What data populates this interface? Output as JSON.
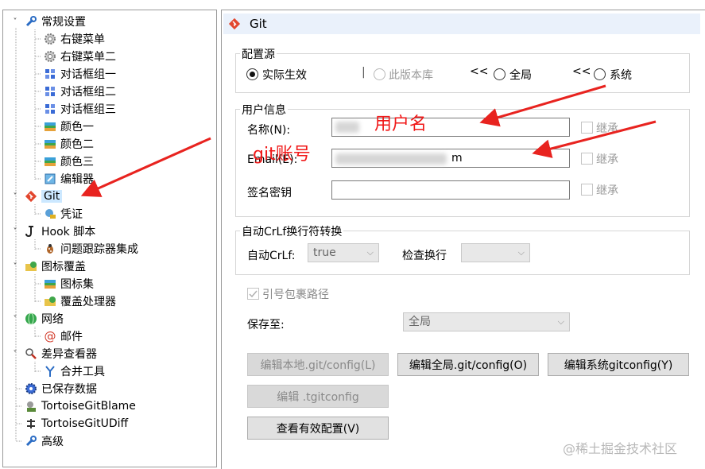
{
  "tree": {
    "items": [
      {
        "label": "常规设置",
        "icon": "wrench-icon"
      },
      {
        "label": "右键菜单",
        "icon": "gear-icon"
      },
      {
        "label": "右键菜单二",
        "icon": "gear-icon"
      },
      {
        "label": "对话框组一",
        "icon": "windows-icon"
      },
      {
        "label": "对话框组二",
        "icon": "windows-icon"
      },
      {
        "label": "对话框组三",
        "icon": "windows-icon"
      },
      {
        "label": "颜色一",
        "icon": "palette-icon"
      },
      {
        "label": "颜色二",
        "icon": "palette-icon"
      },
      {
        "label": "颜色三",
        "icon": "palette-icon"
      },
      {
        "label": "编辑器",
        "icon": "editor-icon"
      },
      {
        "label": "Git",
        "icon": "git-icon"
      },
      {
        "label": "凭证",
        "icon": "credential-icon"
      },
      {
        "label": "Hook 脚本",
        "icon": "hook-icon"
      },
      {
        "label": "问题跟踪器集成",
        "icon": "bug-icon"
      },
      {
        "label": "图标覆盖",
        "icon": "overlay-icon"
      },
      {
        "label": "图标集",
        "icon": "icon-set-icon"
      },
      {
        "label": "覆盖处理器",
        "icon": "overlay-handler-icon"
      },
      {
        "label": "网络",
        "icon": "globe-icon"
      },
      {
        "label": "邮件",
        "icon": "email-icon"
      },
      {
        "label": "差异查看器",
        "icon": "magnifier-icon"
      },
      {
        "label": "合并工具",
        "icon": "merge-icon"
      },
      {
        "label": "已保存数据",
        "icon": "saved-data-icon"
      },
      {
        "label": "TortoiseGitBlame",
        "icon": "blame-icon"
      },
      {
        "label": "TortoiseGitUDiff",
        "icon": "udiff-icon"
      },
      {
        "label": "高级",
        "icon": "wrench-icon"
      }
    ]
  },
  "panel": {
    "title": "Git",
    "config_source": {
      "label": "配置源",
      "effective": "实际生效",
      "repo": "此版本库",
      "global": "全局",
      "system": "系统",
      "separator": "<<",
      "selected": "实际生效"
    },
    "user_info": {
      "label": "用户信息",
      "name_label": "名称(N):",
      "email_label": "Email(E):",
      "email_suffix": "m",
      "signing_key_label": "签名密钥",
      "inherit": "继承"
    },
    "crlf": {
      "label": "自动CrLf换行符转换",
      "autocrlf_label": "自动CrLf:",
      "autocrlf_value": "true",
      "safecrlf_label": "检查换行",
      "safecrlf_value": ""
    },
    "quote_path_label": "引号包裹路径",
    "save_to_label": "保存至:",
    "save_to_value": "全局",
    "buttons": {
      "edit_local": "编辑本地.git/config(L)",
      "edit_global": "编辑全局.git/config(O)",
      "edit_system": "编辑系统gitconfig(Y)",
      "edit_tgitconfig": "编辑 .tgitconfig",
      "view_effective": "查看有效配置(V)"
    }
  },
  "annotations": {
    "username": "用户名",
    "git_account": "git账号",
    "arrow_color": "#e8231f"
  },
  "watermark": "@稀土掘金技术社区"
}
